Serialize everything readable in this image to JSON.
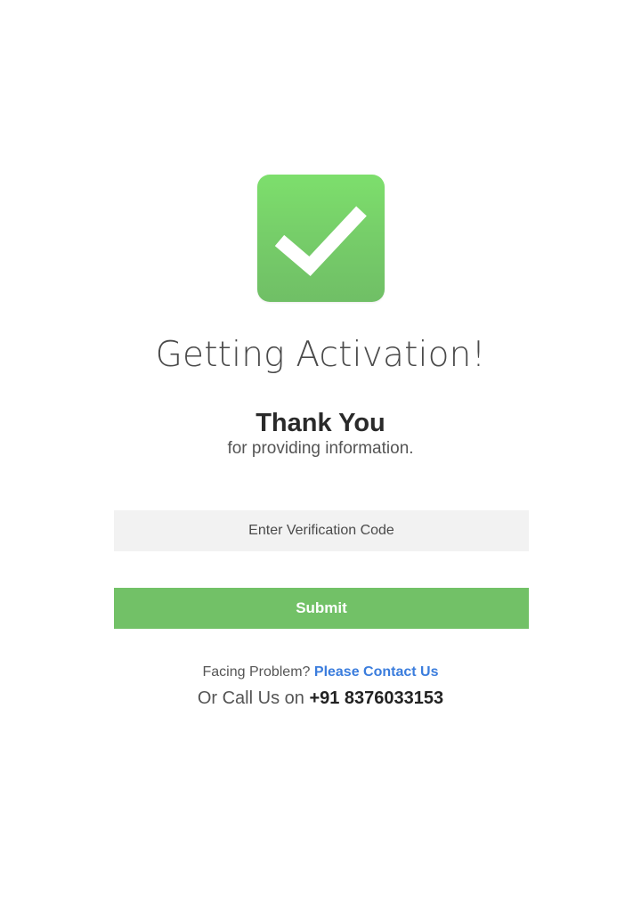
{
  "icon": {
    "name": "checkmark-icon",
    "color": "#76cd69"
  },
  "title": "Getting Activation!",
  "thanks": {
    "heading": "Thank You",
    "subtext": "for providing information."
  },
  "form": {
    "code_placeholder": "Enter Verification Code",
    "code_value": "",
    "submit_label": "Submit",
    "submit_color": "#72c167"
  },
  "help": {
    "prompt": "Facing Problem?",
    "contact_link": "Please Contact Us",
    "call_prefix": "Or Call Us on",
    "phone": "+91 8376033153",
    "link_color": "#3b7ddd"
  }
}
